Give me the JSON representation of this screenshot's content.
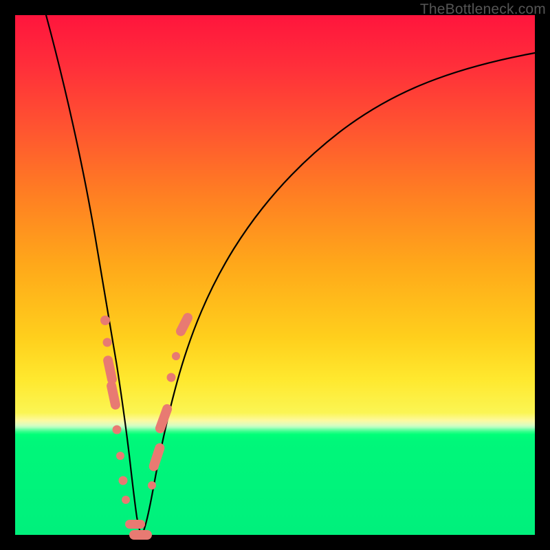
{
  "watermark": "TheBottleneck.com",
  "colors": {
    "frame": "#000000",
    "curve": "#000000",
    "marker": "#e87a72",
    "gradient_top": "#ff153d",
    "gradient_bottom": "#00f07c"
  },
  "chart_data": {
    "type": "line",
    "title": "",
    "xlabel": "",
    "ylabel": "",
    "xlim": [
      0,
      100
    ],
    "ylim": [
      0,
      100
    ],
    "grid": false,
    "legend": false,
    "note": "Axes unlabeled in source; values are approximate percentages of chart extent read from pixel positions.",
    "series": [
      {
        "name": "bottleneck-curve",
        "x": [
          6,
          8,
          10,
          12,
          14,
          16,
          17,
          18,
          19,
          20,
          21,
          22,
          23,
          24,
          25,
          26,
          27,
          29,
          31,
          33,
          36,
          40,
          45,
          50,
          58,
          66,
          74,
          82,
          90,
          100
        ],
        "y": [
          100,
          93,
          86,
          77,
          67,
          55,
          48,
          40,
          31,
          20,
          10,
          3,
          0,
          0,
          2,
          7,
          13,
          24,
          34,
          42,
          51,
          59,
          66,
          71,
          77,
          82,
          85,
          87,
          89,
          91
        ]
      }
    ],
    "markers": [
      {
        "x": 17.3,
        "y": 41.3,
        "shape": "dot"
      },
      {
        "x": 17.8,
        "y": 37.0,
        "shape": "dot"
      },
      {
        "x": 18.2,
        "y": 32.8,
        "shape": "pill",
        "angle": -78,
        "len": 5.5
      },
      {
        "x": 18.8,
        "y": 27.2,
        "shape": "pill",
        "angle": -78,
        "len": 5.5
      },
      {
        "x": 19.6,
        "y": 20.3,
        "shape": "dot"
      },
      {
        "x": 20.2,
        "y": 15.2,
        "shape": "dot"
      },
      {
        "x": 20.8,
        "y": 10.5,
        "shape": "dot"
      },
      {
        "x": 21.3,
        "y": 6.7,
        "shape": "dot"
      },
      {
        "x": 22.2,
        "y": 1.6,
        "shape": "pill",
        "angle": 0,
        "len": 3.8
      },
      {
        "x": 24.0,
        "y": 0.0,
        "shape": "pill",
        "angle": 0,
        "len": 4.4
      },
      {
        "x": 26.3,
        "y": 9.5,
        "shape": "dot"
      },
      {
        "x": 27.2,
        "y": 15.0,
        "shape": "pill",
        "angle": 72,
        "len": 5.5
      },
      {
        "x": 28.5,
        "y": 22.5,
        "shape": "pill",
        "angle": 70,
        "len": 5.8
      },
      {
        "x": 30.0,
        "y": 30.3,
        "shape": "dot"
      },
      {
        "x": 31.0,
        "y": 34.5,
        "shape": "dot"
      },
      {
        "x": 32.5,
        "y": 40.5,
        "shape": "pill",
        "angle": 63,
        "len": 4.8
      }
    ]
  }
}
